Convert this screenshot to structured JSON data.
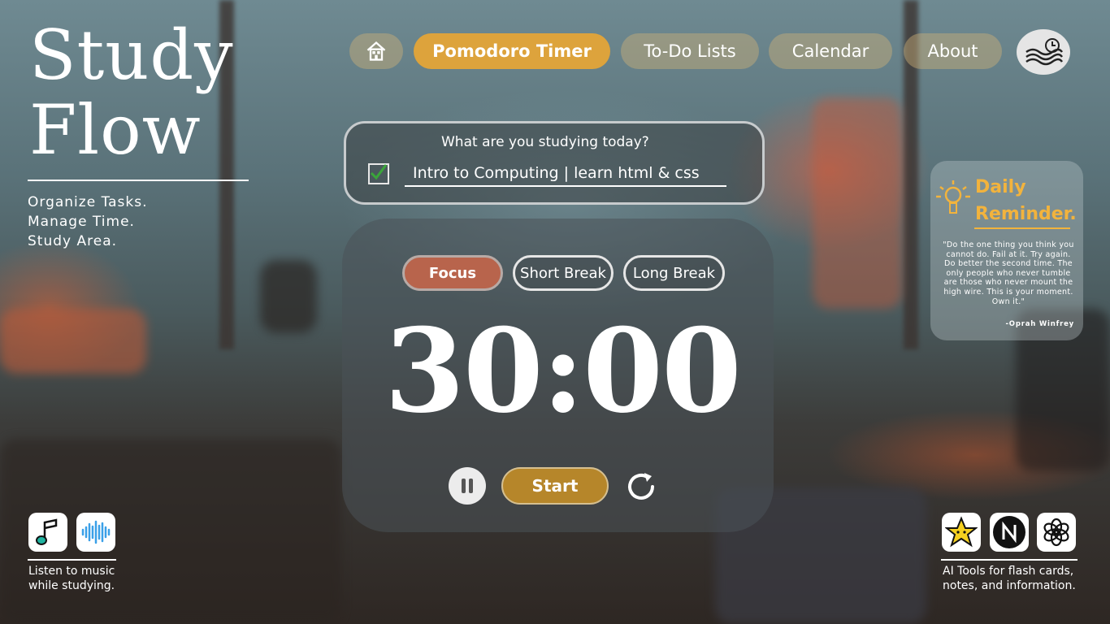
{
  "brand": {
    "title_line1": "Study",
    "title_line2": "Flow",
    "tagline": [
      "Organize Tasks.",
      "Manage Time.",
      "Study Area."
    ]
  },
  "nav": {
    "home_icon": "home-icon",
    "items": [
      {
        "label": "Pomodoro Timer",
        "active": true
      },
      {
        "label": "To-Do Lists",
        "active": false
      },
      {
        "label": "Calendar",
        "active": false
      },
      {
        "label": "About",
        "active": false
      }
    ],
    "profile_icon": "clock-wave-logo-icon"
  },
  "study": {
    "question": "What are you studying today?",
    "checked": true,
    "value": "Intro to Computing | learn html & css"
  },
  "timer": {
    "modes": [
      {
        "label": "Focus",
        "active": true
      },
      {
        "label": "Short Break",
        "active": false
      },
      {
        "label": "Long Break",
        "active": false
      }
    ],
    "display": "30:00",
    "pause_icon": "pause-icon",
    "start_label": "Start",
    "reset_icon": "reset-icon"
  },
  "reminder": {
    "icon": "lightbulb-icon",
    "title_line1": "Daily",
    "title_line2": "Reminder.",
    "quote": "\"Do the one thing you think you cannot do. Fail at it. Try again. Do better the second time. The only people who never tumble are those who never mount the high wire. This is your moment. Own it.\"",
    "author": "-Oprah Winfrey"
  },
  "music": {
    "icons": [
      "music-note-icon",
      "audio-wave-icon"
    ],
    "text_line1": "Listen to music",
    "text_line2": "while studying."
  },
  "ai_tools": {
    "icons": [
      "star-app-icon",
      "notion-icon",
      "openai-icon"
    ],
    "text_line1": "AI Tools for flash cards,",
    "text_line2": "notes, and information."
  },
  "colors": {
    "accent": "#dda33c",
    "focus": "#b8644c",
    "start": "#b6862a",
    "reminder_title": "#f2b33d"
  }
}
